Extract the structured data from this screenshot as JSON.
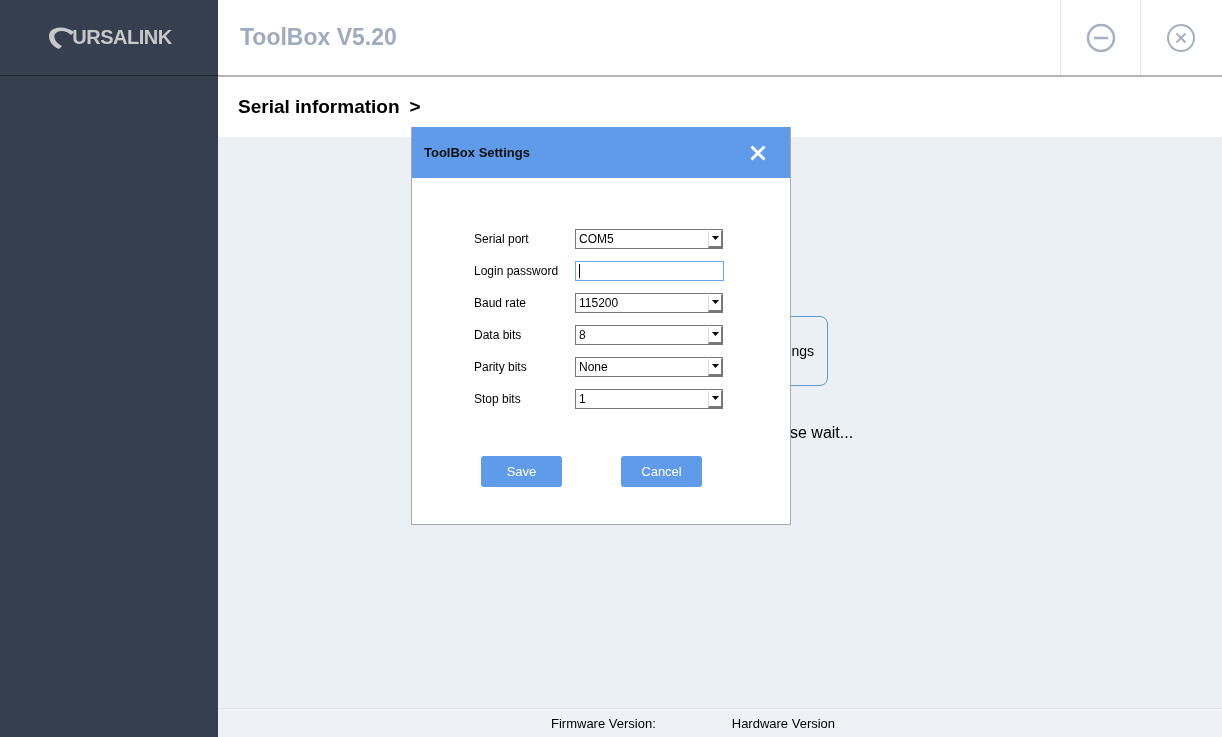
{
  "sidebar": {
    "logo_text": "URSALINK"
  },
  "header": {
    "title": "ToolBox V5.20"
  },
  "breadcrumb": {
    "title": "Serial information",
    "chevron": ">"
  },
  "background": {
    "button_label": "ngs",
    "status_text": "se wait..."
  },
  "dialog": {
    "title": "ToolBox Settings",
    "fields": [
      {
        "label": "Serial port",
        "kind": "select",
        "value": "COM5"
      },
      {
        "label": "Login password",
        "kind": "password",
        "focused": true
      },
      {
        "label": "Baud rate",
        "kind": "select",
        "value": "115200"
      },
      {
        "label": "Data bits",
        "kind": "select",
        "value": "8"
      },
      {
        "label": "Parity bits",
        "kind": "select",
        "value": "None"
      },
      {
        "label": "Stop bits",
        "kind": "select",
        "value": "1"
      }
    ],
    "buttons": [
      "Save",
      "Cancel"
    ]
  },
  "footer": {
    "firmware_label": "Firmware Version:",
    "hardware_label": "Hardware Version"
  }
}
